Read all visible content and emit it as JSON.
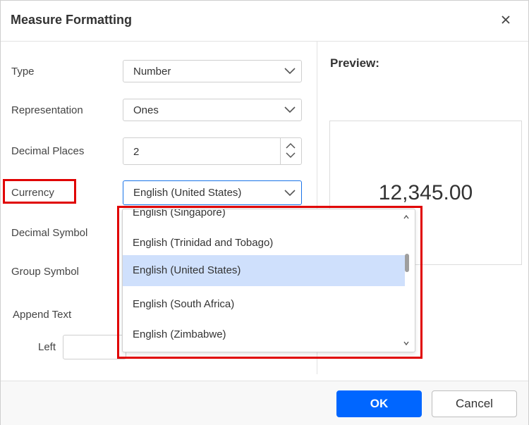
{
  "dialog": {
    "title": "Measure Formatting"
  },
  "form": {
    "type": {
      "label": "Type",
      "value": "Number"
    },
    "representation": {
      "label": "Representation",
      "value": "Ones"
    },
    "decimal_places": {
      "label": "Decimal Places",
      "value": "2"
    },
    "currency": {
      "label": "Currency",
      "value": "English (United States)"
    },
    "decimal_symbol": {
      "label": "Decimal Symbol"
    },
    "group_symbol": {
      "label": "Group Symbol"
    },
    "append_text": {
      "label": "Append Text",
      "left_label": "Left"
    }
  },
  "preview": {
    "label": "Preview:",
    "value": "12,345.00"
  },
  "currency_dropdown": {
    "items": [
      {
        "label": "English (Singapore)",
        "selected": false
      },
      {
        "label": "English (Trinidad and Tobago)",
        "selected": false
      },
      {
        "label": "English (United States)",
        "selected": true
      },
      {
        "label": "English (South Africa)",
        "selected": false
      },
      {
        "label": "English (Zimbabwe)",
        "selected": false
      }
    ]
  },
  "footer": {
    "ok_label": "OK",
    "cancel_label": "Cancel"
  },
  "colors": {
    "primary": "#0066ff",
    "selected_item": "#cfe0fc",
    "highlight": "#e00000",
    "focus_border": "#1a73e8"
  },
  "icons": {
    "close": "close-icon",
    "chevron": "chevron-down-icon",
    "spin_up": "chevron-up-icon",
    "spin_down": "chevron-down-icon"
  }
}
